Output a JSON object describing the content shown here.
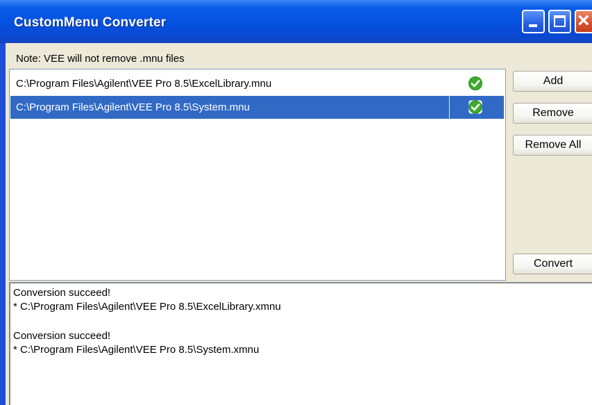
{
  "window": {
    "title": "CustomMenu Converter"
  },
  "note": "Note: VEE will not remove .mnu files",
  "files": [
    {
      "path": "C:\\Program Files\\Agilent\\VEE Pro 8.5\\ExcelLibrary.mnu",
      "status": "check-icon",
      "selected": false
    },
    {
      "path": "C:\\Program Files\\Agilent\\VEE Pro 8.5\\System.mnu",
      "status": "check-icon",
      "selected": true
    }
  ],
  "buttons": {
    "add": "Add",
    "remove": "Remove",
    "remove_all": "Remove All",
    "convert": "Convert"
  },
  "log": [
    "Conversion succeed!",
    "* C:\\Program Files\\Agilent\\VEE Pro 8.5\\ExcelLibrary.xmnu",
    "Conversion succeed!",
    "* C:\\Program Files\\Agilent\\VEE Pro 8.5\\System.xmnu"
  ],
  "colors": {
    "selection": "#316ac5",
    "check_green": "#3faa2c"
  }
}
